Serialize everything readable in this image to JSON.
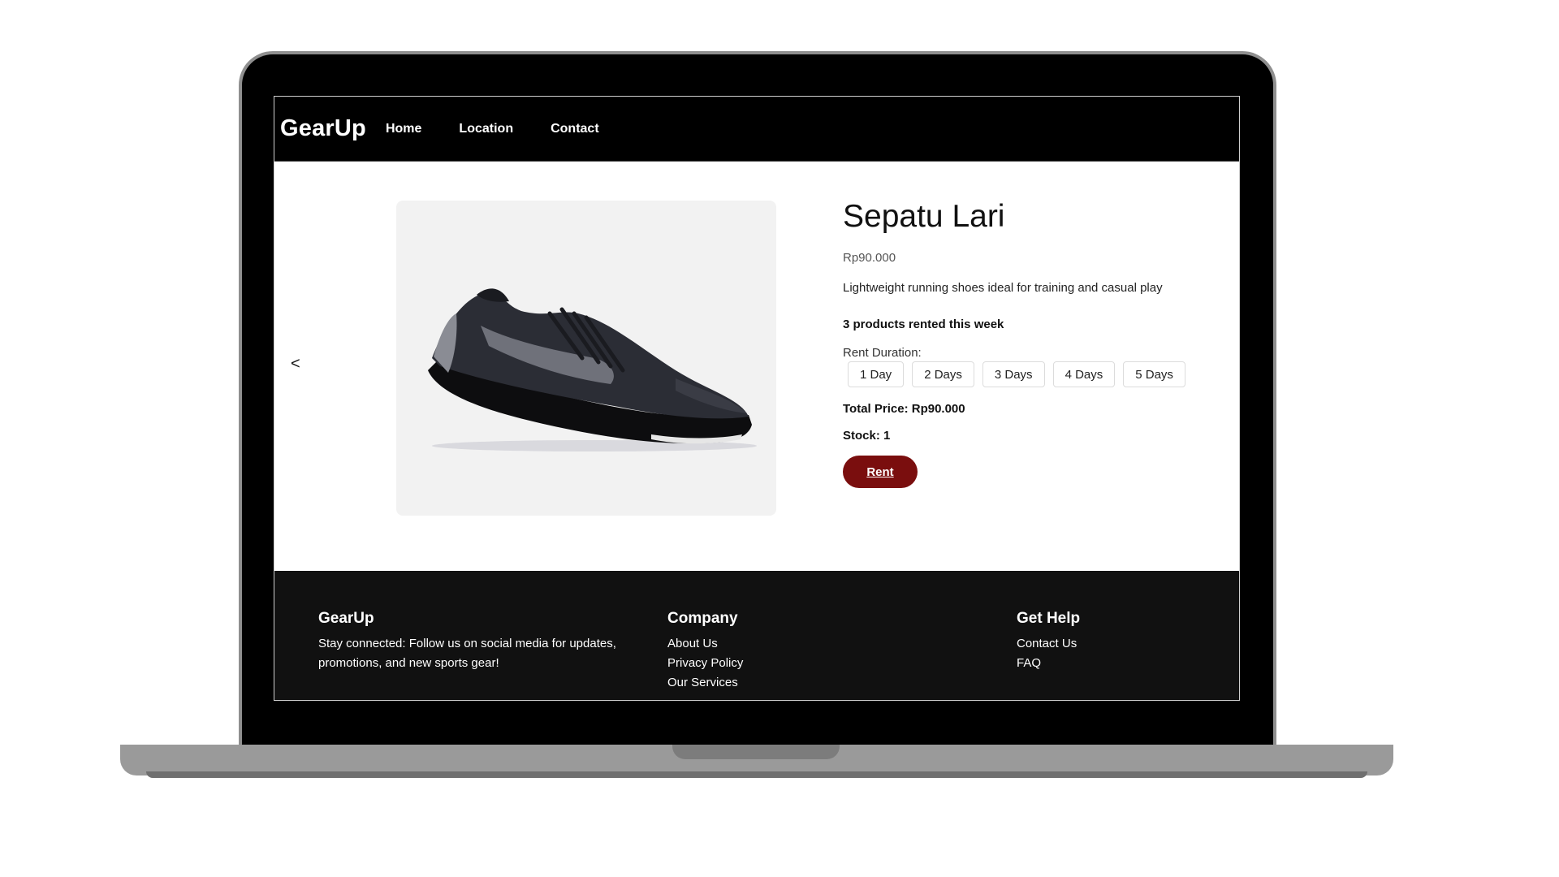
{
  "nav": {
    "brand": "GearUp",
    "links": [
      "Home",
      "Location",
      "Contact"
    ]
  },
  "product": {
    "prev_arrow": "<",
    "title": "Sepatu Lari",
    "price": "Rp90.000",
    "description": "Lightweight running shoes ideal for training and casual play",
    "rented_this_week": "3 products rented this week",
    "duration_label": "Rent Duration:",
    "durations": [
      "1 Day",
      "2 Days",
      "3 Days",
      "4 Days",
      "5 Days"
    ],
    "total_price": "Total Price: Rp90.000",
    "stock": "Stock: 1",
    "rent_label": "Rent",
    "accent_color": "#7a0e0e"
  },
  "footer": {
    "brand": {
      "title": "GearUp",
      "text": "Stay connected: Follow us on social media for updates, promotions, and new sports gear!"
    },
    "company": {
      "title": "Company",
      "links": [
        "About Us",
        "Privacy Policy",
        "Our Services"
      ]
    },
    "help": {
      "title": "Get Help",
      "links": [
        "Contact Us",
        "FAQ"
      ]
    }
  }
}
